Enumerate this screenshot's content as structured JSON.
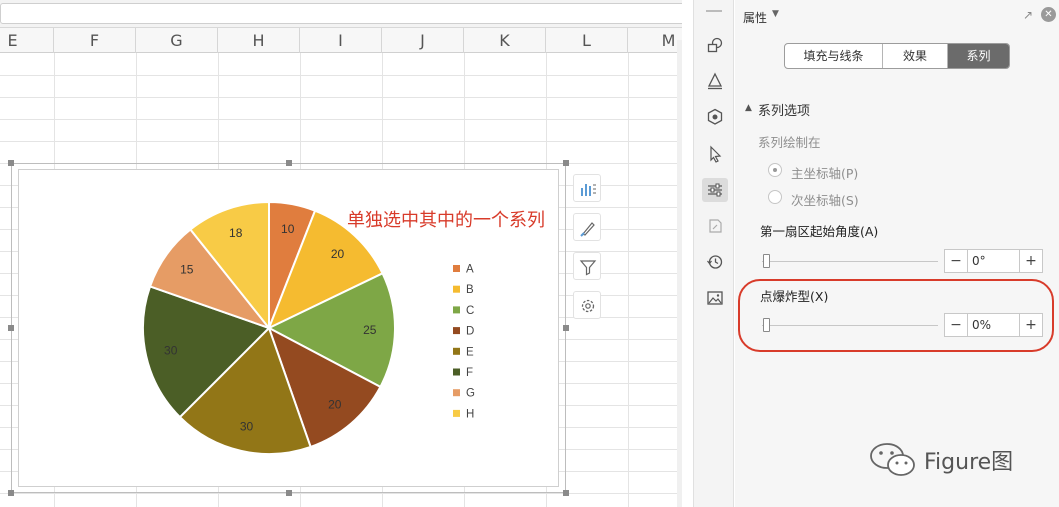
{
  "sheet": {
    "columns": [
      "E",
      "F",
      "G",
      "H",
      "I",
      "J",
      "K",
      "L",
      "M"
    ]
  },
  "annotation": "单独选中其中的一个系列",
  "chart_data": {
    "type": "pie",
    "title": "",
    "categories": [
      "A",
      "B",
      "C",
      "D",
      "E",
      "F",
      "G",
      "H"
    ],
    "values": [
      10,
      20,
      25,
      20,
      30,
      30,
      15,
      18
    ],
    "colors": [
      "#e07d3e",
      "#f5bb30",
      "#7ea746",
      "#944a20",
      "#927617",
      "#4b5e26",
      "#e69c65",
      "#f8cb46"
    ],
    "legend_position": "right",
    "data_labels": true
  },
  "chart_tools": [
    {
      "name": "chart-elements-icon"
    },
    {
      "name": "chart-style-brush-icon"
    },
    {
      "name": "chart-filter-icon"
    },
    {
      "name": "chart-settings-icon"
    }
  ],
  "rail_icons": [
    "shapes-icon",
    "styles-icon",
    "effects-icon",
    "select-icon",
    "properties-icon",
    "transform-icon",
    "history-icon",
    "image-icon"
  ],
  "panel": {
    "title": "属性",
    "tabs": [
      {
        "label": "填充与线条",
        "active": false
      },
      {
        "label": "效果",
        "active": false
      },
      {
        "label": "系列",
        "active": true
      }
    ],
    "series_options_title": "系列选项",
    "plot_on_label": "系列绘制在",
    "primary_axis": "主坐标轴(P)",
    "secondary_axis": "次坐标轴(S)",
    "first_slice_angle_label": "第一扇区起始角度(A)",
    "first_slice_angle_value": "0°",
    "point_explosion_label": "点爆炸型(X)",
    "point_explosion_value": "0%",
    "minus": "−",
    "plus": "+"
  },
  "watermark": "Figure图"
}
